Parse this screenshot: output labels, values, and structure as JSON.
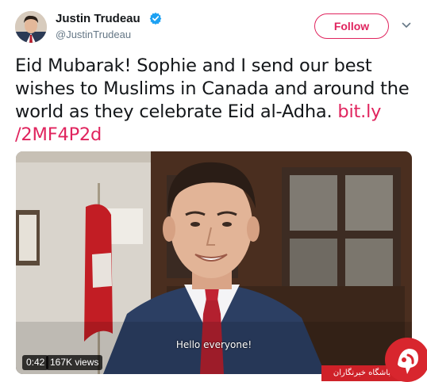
{
  "author": {
    "name": "Justin Trudeau",
    "handle": "@JustinTrudeau",
    "verified_icon": "verified-badge-icon"
  },
  "actions": {
    "follow_label": "Follow",
    "menu_icon": "chevron-down-icon"
  },
  "tweet": {
    "text": "Eid Mubarak! Sophie and I send our best wishes to Muslims in Canada and around the world as they celebrate Eid al-Adha. ",
    "link_text": "bit.ly /2MF4P2d"
  },
  "video": {
    "subtitle": "Hello everyone!",
    "duration": "0:42",
    "views": "167K views"
  },
  "watermark": {
    "text": "باشگاه خبرنگاران"
  },
  "colors": {
    "accent": "#e0245e",
    "verified": "#1da1f2",
    "watermark_red": "#cf2128"
  }
}
